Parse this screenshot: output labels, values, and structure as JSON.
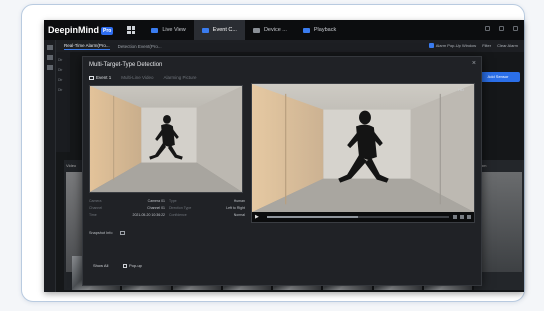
{
  "app": {
    "name": "DeepinMind",
    "badge": "Pro"
  },
  "nav": {
    "tabs": [
      {
        "label": "Live View",
        "active": false
      },
      {
        "label": "Event C...",
        "active": true
      },
      {
        "label": "Device ...",
        "active": false
      },
      {
        "label": "Playback",
        "active": false
      }
    ]
  },
  "subtabs": [
    {
      "label": "Real-Time Alarm(Pro...",
      "active": true
    },
    {
      "label": "Detection Event(Pro...",
      "active": false
    }
  ],
  "toolbar_right": {
    "option1": "Alarm Pop-Up Window",
    "option2": "Filter",
    "option3": "Clear Alarm"
  },
  "background": {
    "add_button": "Add Sensor",
    "left_header": "Video",
    "right_header": "Cam"
  },
  "modal": {
    "title": "Multi-Target-Type Detection",
    "tabs": [
      {
        "label": "Event 1",
        "active": true
      },
      {
        "label": "Multi-Line Video",
        "active": false
      },
      {
        "label": "Alarming Picture",
        "active": false
      }
    ],
    "video_resolution": "HD",
    "details": [
      {
        "key": "Camera",
        "value": "Camera 01"
      },
      {
        "key": "Type",
        "value": "Human"
      },
      {
        "key": "Channel",
        "value": "Channel 01"
      },
      {
        "key": "Direction Type",
        "value": "Left to Right"
      },
      {
        "key": "Time",
        "value": "2021-05-20 10:36:22"
      },
      {
        "key": "Confidence",
        "value": "Normal"
      }
    ],
    "snapshot_label": "Snapshot Info",
    "show_all": "Show All",
    "pop_up": "Pop-up"
  },
  "colors": {
    "accent": "#2b6fe8",
    "screen_bg": "#151719",
    "card_border": "#b9cbe0"
  }
}
